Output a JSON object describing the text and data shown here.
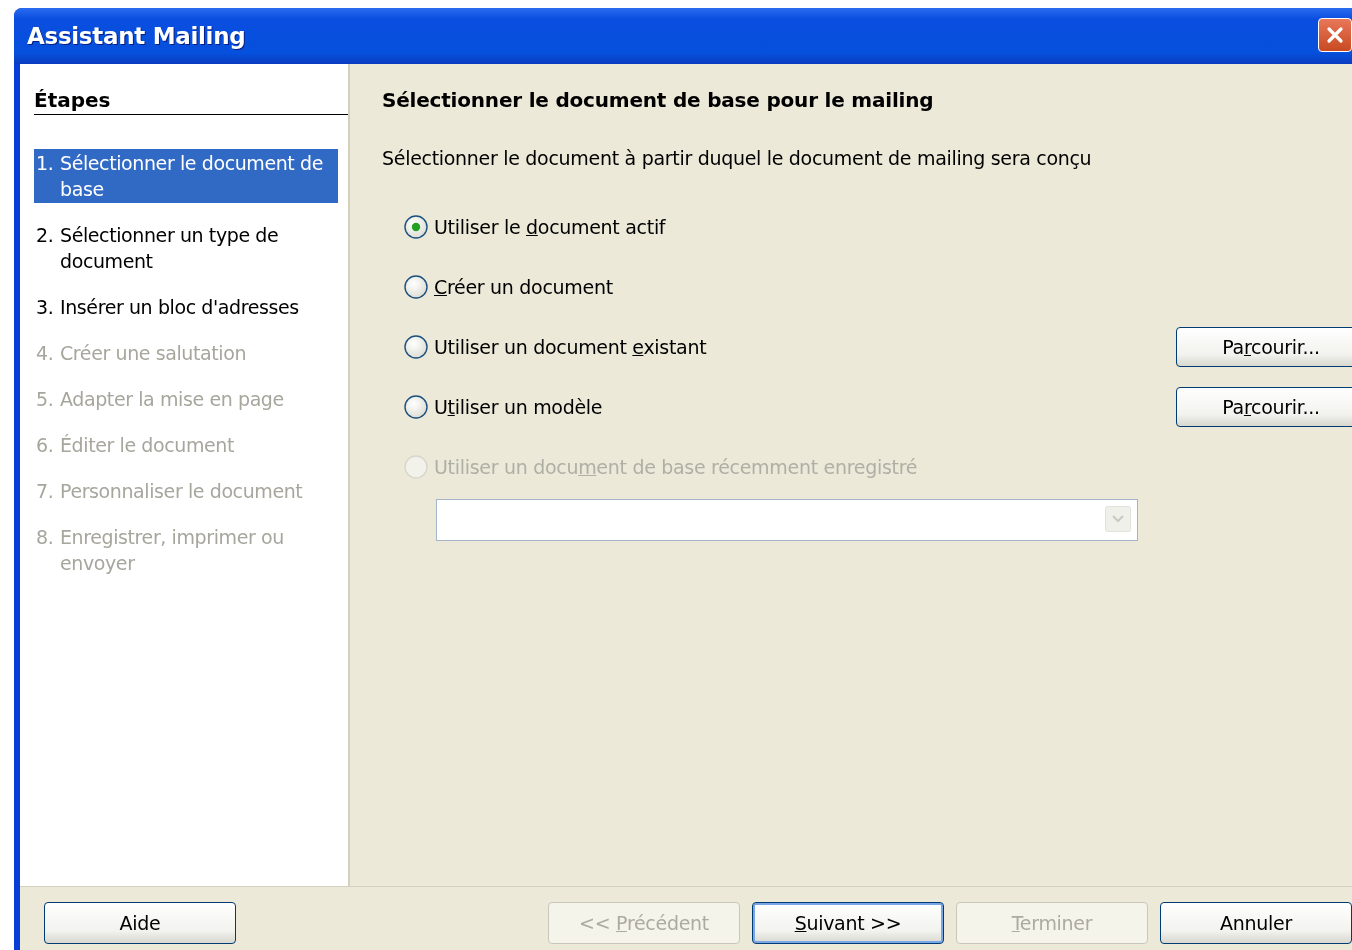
{
  "window": {
    "title": "Assistant Mailing"
  },
  "steps": {
    "heading": "Étapes",
    "items": [
      {
        "number": "1.",
        "text": "Sélectionner le document de base",
        "selected": true,
        "disabled": false
      },
      {
        "number": "2.",
        "text": "Sélectionner un type de document",
        "selected": false,
        "disabled": false
      },
      {
        "number": "3.",
        "text": "Insérer un bloc d'adresses",
        "selected": false,
        "disabled": false
      },
      {
        "number": "4.",
        "text": "Créer une salutation",
        "selected": false,
        "disabled": true
      },
      {
        "number": "5.",
        "text": "Adapter la mise en page",
        "selected": false,
        "disabled": true
      },
      {
        "number": "6.",
        "text": "Éditer le document",
        "selected": false,
        "disabled": true
      },
      {
        "number": "7.",
        "text": "Personnaliser le document",
        "selected": false,
        "disabled": true
      },
      {
        "number": "8.",
        "text": "Enregistrer, imprimer ou envoyer",
        "selected": false,
        "disabled": true
      }
    ]
  },
  "page": {
    "title": "Sélectionner le document de base pour le mailing",
    "description": "Sélectionner le document à partir duquel le document de mailing sera conçu",
    "options": [
      {
        "label": {
          "pre": "Utiliser le ",
          "key": "d",
          "post": "ocument actif"
        },
        "selected": true,
        "disabled": false
      },
      {
        "label": {
          "key": "C",
          "post": "réer un document"
        },
        "selected": false,
        "disabled": false
      },
      {
        "label": {
          "pre": "Utiliser un document ",
          "key": "e",
          "post": "xistant"
        },
        "selected": false,
        "disabled": false,
        "browse": {
          "pre": "Pa",
          "key": "r",
          "post": "courir..."
        }
      },
      {
        "label": {
          "pre": "U",
          "key": "t",
          "post": "iliser un modèle"
        },
        "selected": false,
        "disabled": false,
        "browse": {
          "pre": "Pa",
          "key": "r",
          "post": "courir..."
        }
      },
      {
        "label": {
          "pre": "Utiliser un docu",
          "key": "m",
          "post": "ent de base récemment enregistré"
        },
        "selected": false,
        "disabled": true
      }
    ],
    "recent_dropdown": {
      "disabled": true
    }
  },
  "buttons": [
    {
      "label": {
        "pre": "Aide"
      },
      "disabled": false,
      "default": false,
      "kind": "left"
    },
    {
      "label": {
        "pre": "<< ",
        "key": "P",
        "post": "récédent"
      },
      "disabled": true,
      "default": false,
      "kind": "right"
    },
    {
      "label": {
        "key": "S",
        "post": "uivant >>"
      },
      "disabled": false,
      "default": true,
      "kind": "right"
    },
    {
      "label": {
        "key": "T",
        "post": "erminer"
      },
      "disabled": true,
      "default": false,
      "kind": "right"
    },
    {
      "label": {
        "pre": "Annuler"
      },
      "disabled": false,
      "default": false,
      "kind": "right"
    }
  ]
}
